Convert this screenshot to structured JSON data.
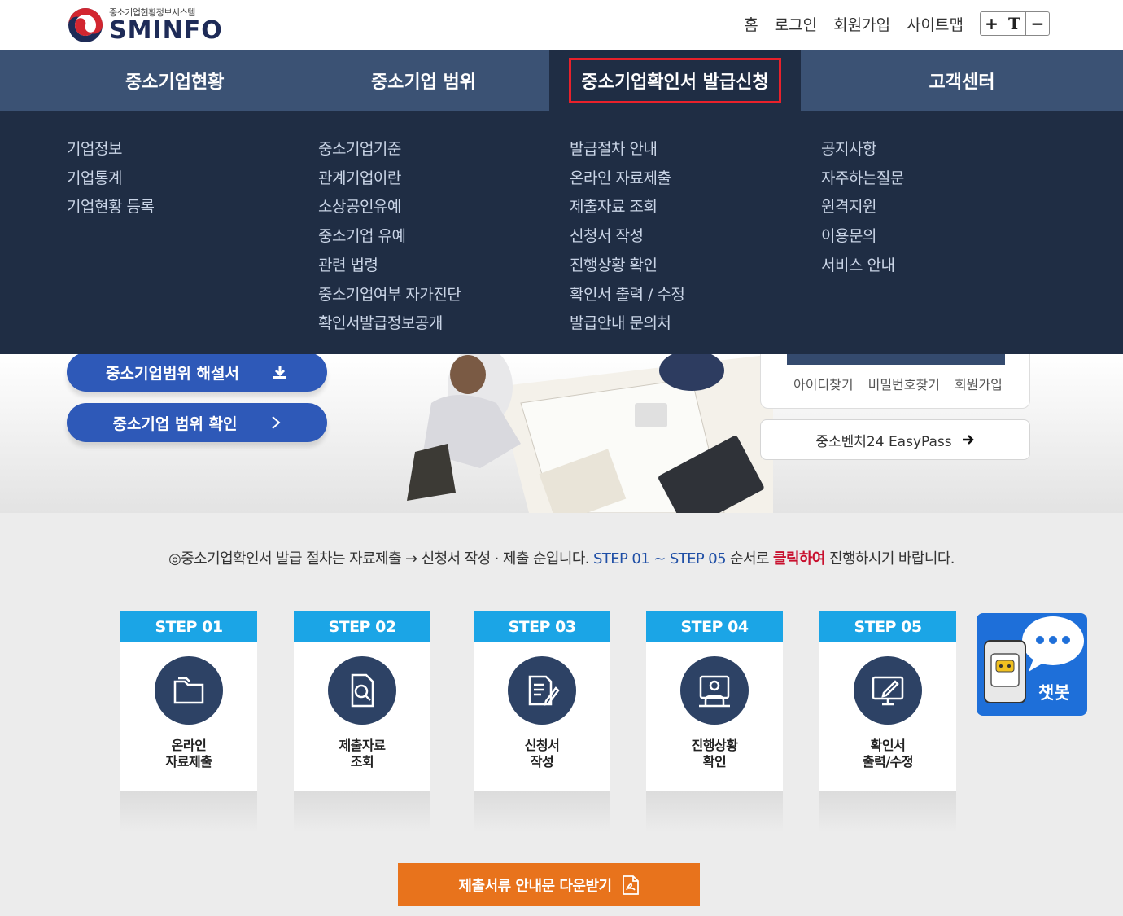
{
  "header": {
    "logo_sub": "중소기업현황정보시스템",
    "logo_main": "SMINFO",
    "util_links": [
      "홈",
      "로그인",
      "회원가입",
      "사이트맵"
    ],
    "font_controls": [
      "+",
      "T",
      "−"
    ]
  },
  "nav": {
    "items": [
      "중소기업현황",
      "중소기업 범위",
      "중소기업확인서 발급신청",
      "고객센터"
    ],
    "active_index": 2
  },
  "mega_menu": {
    "col1": [
      "기업정보",
      "기업통계",
      "기업현황 등록"
    ],
    "col2": [
      "중소기업기준",
      "관계기업이란",
      "소상공인유예",
      "중소기업 유예",
      "관련 법령",
      "중소기업여부 자가진단",
      "확인서발급정보공개"
    ],
    "col3": [
      "발급절차 안내",
      "온라인 자료제출",
      "제출자료 조회",
      "신청서 작성",
      "진행상황 확인",
      "확인서 출력 / 수정",
      "발급안내 문의처"
    ],
    "col4": [
      "공지사항",
      "자주하는질문",
      "원격지원",
      "이용문의",
      "서비스 안내"
    ]
  },
  "hero": {
    "pill1": "중소기업범위 해설서",
    "pill2": "중소기업 범위 확인",
    "login_links": [
      "아이디찾기",
      "비밀번호찾기",
      "회원가입"
    ],
    "easypass": "중소벤처24 EasyPass"
  },
  "notice": {
    "part1": "◎중소기업확인서 발급 절차는 자료제출 → 신청서 작성 · 제출 순입니다. ",
    "part2": "STEP 01 ~ STEP 05",
    "part3": " 순서로 ",
    "part4": "클릭하여",
    "part5": " 진행하시기 바랍니다."
  },
  "steps": [
    {
      "head": "STEP 01",
      "line1": "온라인",
      "line2": "자료제출",
      "icon": "folder-icon"
    },
    {
      "head": "STEP 02",
      "line1": "제출자료",
      "line2": "조회",
      "icon": "document-search-icon"
    },
    {
      "head": "STEP 03",
      "line1": "신청서",
      "line2": "작성",
      "icon": "document-edit-icon"
    },
    {
      "head": "STEP 04",
      "line1": "진행상황",
      "line2": "확인",
      "icon": "monitor-person-icon"
    },
    {
      "head": "STEP 05",
      "line1": "확인서",
      "line2": "출력/수정",
      "icon": "monitor-pen-icon"
    }
  ],
  "chatbot": {
    "label": "챗봇"
  },
  "download": {
    "label": "제출서류 안내문 다운받기"
  },
  "colors": {
    "nav_bg": "#3b5274",
    "mega_bg": "#1f2d44",
    "step_head": "#1ba5e6",
    "pill": "#2e59b8",
    "download": "#e8731c",
    "active_outline": "#e8212b"
  }
}
